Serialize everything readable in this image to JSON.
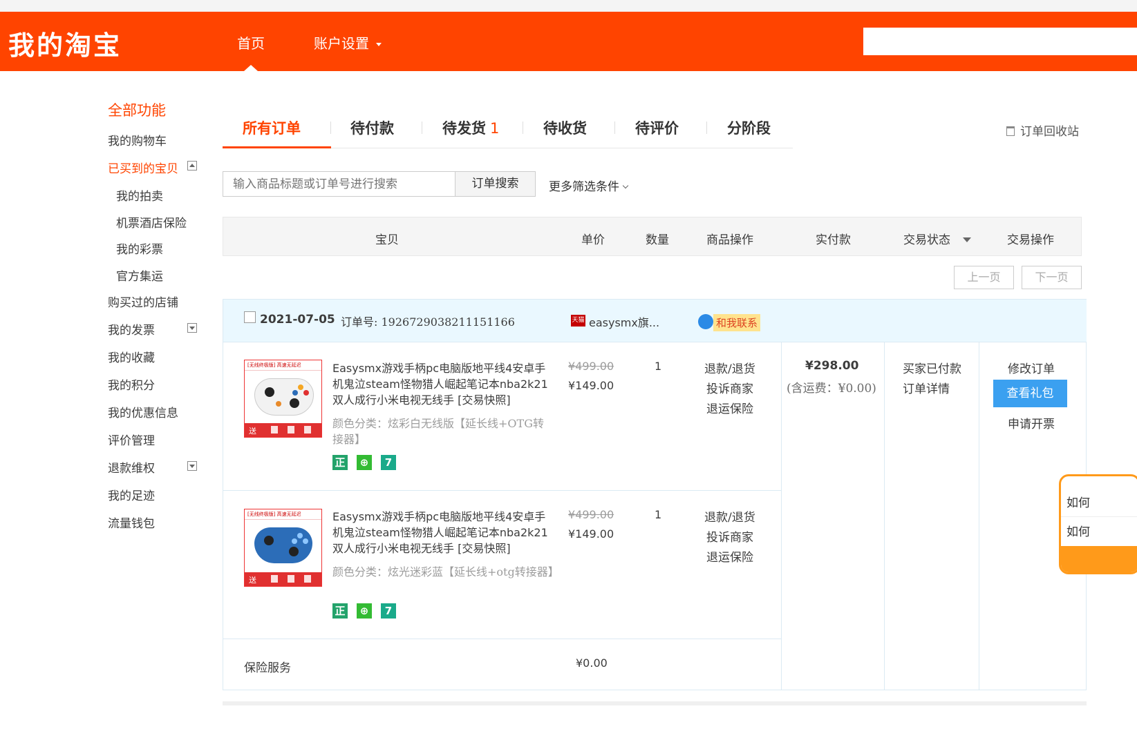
{
  "header": {
    "logo": "我的淘宝",
    "nav_home": "首页",
    "nav_account": "账户设置"
  },
  "colors": {
    "brand": "#ff4400",
    "accent_blue": "#3ba0f0",
    "order_header_bg": "#eaf8ff"
  },
  "sidebar": {
    "title": "全部功能",
    "items": [
      {
        "label": "我的购物车"
      },
      {
        "label": "已买到的宝贝",
        "active": true
      },
      {
        "label": "我的拍卖",
        "sub": true
      },
      {
        "label": "机票酒店保险",
        "sub": true
      },
      {
        "label": "我的彩票",
        "sub": true
      },
      {
        "label": "官方集运",
        "sub": true
      },
      {
        "label": "购买过的店铺"
      },
      {
        "label": "我的发票"
      },
      {
        "label": "我的收藏"
      },
      {
        "label": "我的积分"
      },
      {
        "label": "我的优惠信息"
      },
      {
        "label": "评价管理"
      },
      {
        "label": "退款维权"
      },
      {
        "label": "我的足迹"
      },
      {
        "label": "流量钱包"
      }
    ]
  },
  "tabs": [
    {
      "label": "所有订单",
      "active": true
    },
    {
      "label": "待付款"
    },
    {
      "label": "待发货",
      "count": "1"
    },
    {
      "label": "待收货"
    },
    {
      "label": "待评价"
    },
    {
      "label": "分阶段"
    }
  ],
  "recycle_bin": "订单回收站",
  "search": {
    "placeholder": "输入商品标题或订单号进行搜索",
    "button": "订单搜索",
    "more_filters": "更多筛选条件"
  },
  "table_headers": {
    "item": "宝贝",
    "price": "单价",
    "qty": "数量",
    "item_ops": "商品操作",
    "paid": "实付款",
    "status": "交易状态",
    "actions": "交易操作"
  },
  "pager": {
    "prev": "上一页",
    "next": "下一页"
  },
  "order": {
    "date": "2021-07-05",
    "order_no_label": "订单号:",
    "order_no": "1926729038211151166",
    "store_badge": "天猫",
    "store_name": "easysmx旗...",
    "contact": "和我联系",
    "items": [
      {
        "title": "Easysmx游戏手柄pc电脑版地平线4安卓手机鬼泣steam怪物猎人崛起笔记本nba2k21双人成行小米电视无线手 [交易快照]",
        "sku": "颜色分类：炫彩白无线版【延长线+OTG转接器】",
        "thumb_banner": "[无线终极版] 高速无延迟",
        "thumb_gift": "送",
        "price_original": "¥499.00",
        "price_now": "¥149.00",
        "qty": "1",
        "ops": [
          "退款/退货",
          "投诉商家",
          "退运保险"
        ],
        "badges": [
          "正",
          "⊕",
          "7"
        ]
      },
      {
        "title": "Easysmx游戏手柄pc电脑版地平线4安卓手机鬼泣steam怪物猎人崛起笔记本nba2k21双人成行小米电视无线手 [交易快照]",
        "sku": "颜色分类：炫光迷彩蓝【延长线+otg转接器】",
        "thumb_banner": "[无线终极版] 高速无延迟",
        "thumb_gift": "送",
        "price_original": "¥499.00",
        "price_now": "¥149.00",
        "qty": "1",
        "ops": [
          "退款/退货",
          "投诉商家",
          "退运保险"
        ],
        "badges": [
          "正",
          "⊕",
          "7"
        ]
      }
    ],
    "paid_amount": "¥298.00",
    "paid_note": "(含运费：¥0.00)",
    "status": [
      "买家已付款",
      "订单详情"
    ],
    "actions": {
      "modify": "修改订单",
      "view_gift": "查看礼包",
      "invoice": "申请开票"
    },
    "insurance_label": "保险服务",
    "insurance_price": "¥0.00"
  },
  "float_panel": {
    "line1": "如何",
    "line2": "如何"
  }
}
